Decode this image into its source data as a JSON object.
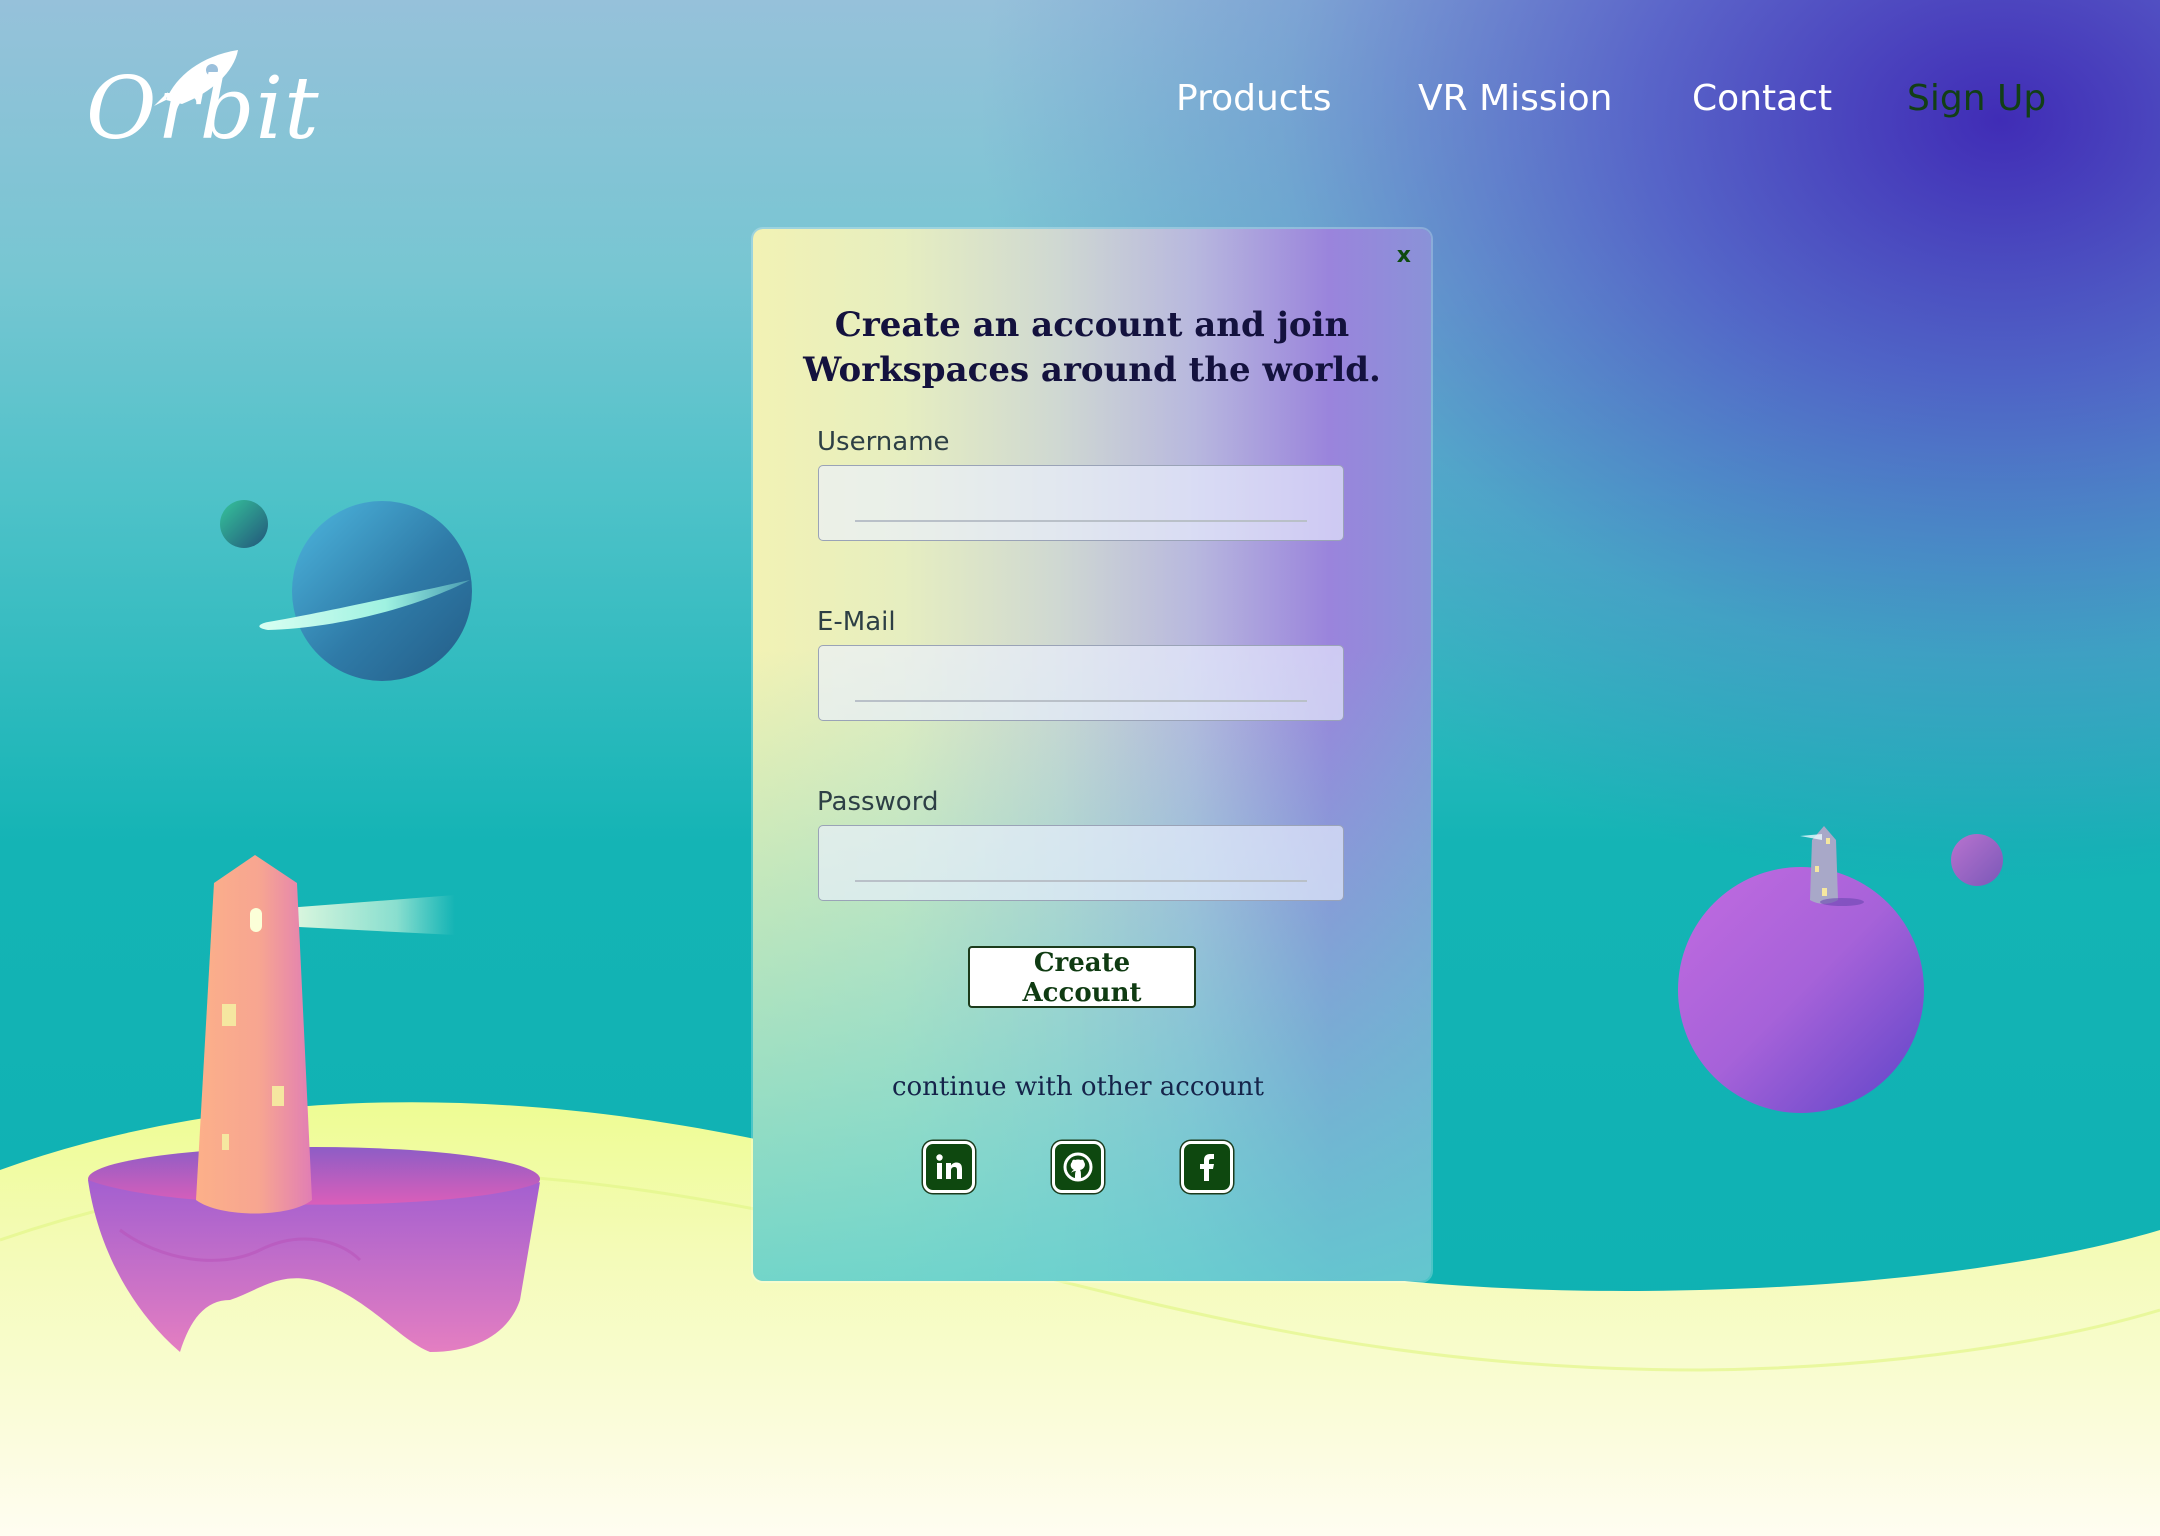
{
  "brand": {
    "logo_text": "Orbit"
  },
  "nav": {
    "items": [
      "Products",
      "VR Mission",
      "Contact"
    ],
    "signup_label": "Sign Up"
  },
  "modal": {
    "close_label": "x",
    "title_line1": "Create an account and join",
    "title_line2": "Workspaces around the world.",
    "fields": [
      {
        "label": "Username",
        "value": ""
      },
      {
        "label": "E-Mail",
        "value": ""
      },
      {
        "label": "Password",
        "value": ""
      }
    ],
    "submit_label": "Create Account",
    "continue_text": "continue with other account",
    "social": [
      "linkedin-icon",
      "github-icon",
      "facebook-icon"
    ]
  },
  "colors": {
    "accent_green": "#0e480f",
    "title_navy": "#14123e",
    "sky_violet": "#3c24b4",
    "sky_teal": "#0cb0b2",
    "ground_yellow": "#eefc93"
  }
}
